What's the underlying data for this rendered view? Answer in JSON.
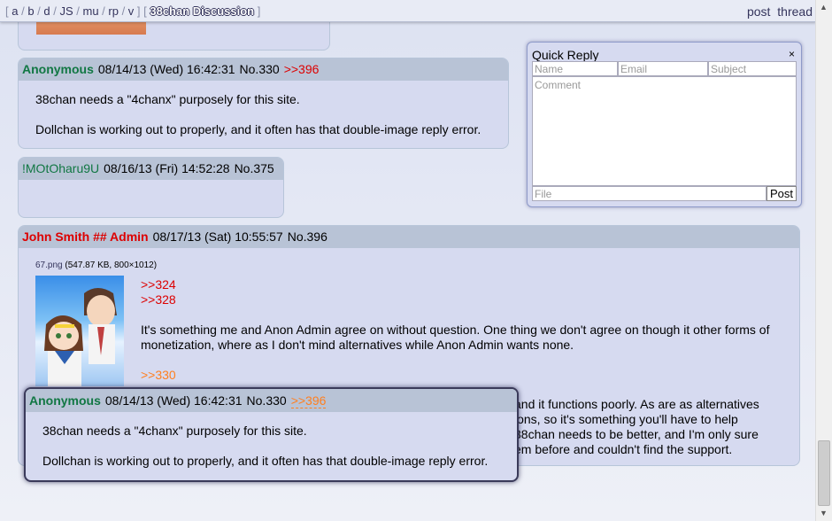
{
  "nav": {
    "boards": [
      "a",
      "b",
      "d",
      "JS",
      "mu",
      "rp",
      "v"
    ],
    "current_thread": "38chan Discussion",
    "post_label": "post",
    "thread_label": "thread"
  },
  "posts": [
    {
      "name": "Anonymous",
      "date": "08/14/13 (Wed) 16:42:31",
      "number": "No.330",
      "backlink": ">>396",
      "body": [
        "38chan needs a \"4chanx\" purposely for this site.",
        "Dollchan is working out to properly, and it often has that double-image reply error."
      ]
    },
    {
      "name": "!MOtOharu9U",
      "date": "08/16/13 (Fri) 14:52:28",
      "number": "No.375",
      "body": []
    },
    {
      "name": "John Smith ## Admin",
      "date": "08/17/13 (Sat) 10:55:57",
      "number": "No.396",
      "file": {
        "name": "67.png",
        "info": "(547.87 KB, 800×1012)"
      },
      "quotes": [
        ">>324",
        ">>328"
      ],
      "paragraph1": "It's something me and Anon Admin agree on without question. One thing we don't agree on though it other forms of monetization, where as I don't mind alternatives while Anon Admin wants none.",
      "quote2": ">>330",
      "trailing_lines": [
        "and it functions poorly. As are as alternatives",
        "ions, so it's something you'll have to help",
        "38chan needs to be better, and I'm only sure",
        "em before and couldn't find the support."
      ]
    }
  ],
  "preview": {
    "name": "Anonymous",
    "date": "08/14/13 (Wed) 16:42:31",
    "number": "No.330",
    "backlink": ">>396",
    "body": [
      "38chan needs a \"4chanx\" purposely for this site.",
      "Dollchan is working out to properly, and it often has that double-image reply error."
    ]
  },
  "quick_reply": {
    "title": "Quick Reply",
    "close": "×",
    "name_placeholder": "Name",
    "email_placeholder": "Email",
    "subject_placeholder": "Subject",
    "comment_placeholder": "Comment",
    "file_placeholder": "File",
    "post_button": "Post"
  },
  "colors": {
    "reply_bg": "#d6daf0",
    "header_bg": "#b8c3d6",
    "name_green": "#117743",
    "admin_red": "#dd0000",
    "quotelink_red": "#dd0000",
    "quotelink_orange": "#ff7f1f"
  }
}
